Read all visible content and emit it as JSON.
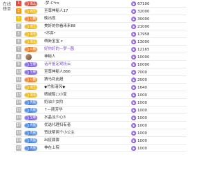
{
  "sidebar": {
    "label": "在线榜单"
  },
  "leaderboard": [
    {
      "rank": "1",
      "badge": "国王",
      "badge_color": "red",
      "name": "-梦-C*ro",
      "score": "67100"
    },
    {
      "rank": "2",
      "badge": "国王",
      "badge_color": "gold",
      "name": "至尊神秘人17",
      "score": "32000"
    },
    {
      "rank": "3",
      "badge": "公爵",
      "badge_color": "orange",
      "name": "晚出现",
      "score": "30000"
    },
    {
      "rank": "4",
      "badge": "国王",
      "badge_color": "gold",
      "name": "美好的你看来来88",
      "score": "21000"
    },
    {
      "rank": "5",
      "badge": "国王",
      "badge_color": "gold",
      "name": "*不弃*",
      "score": "17958"
    },
    {
      "rank": "6",
      "badge": "国王",
      "badge_color": "gold",
      "name": "萌新宝宝 c",
      "score": "13000"
    },
    {
      "rank": "7",
      "badge": "公爵",
      "badge_color": "orange",
      "name": "好你好的—梦~菌",
      "score": "12165"
    },
    {
      "rank": "8",
      "badge": "",
      "badge_color": "",
      "name": "神秘人",
      "score": "10000"
    },
    {
      "rank": "9",
      "badge": "至尊",
      "badge_color": "purple",
      "name": "话开鉴定观抚云",
      "score": "10000"
    },
    {
      "rank": "10",
      "badge": "至尊",
      "badge_color": "purple",
      "name": "至尊神秘人866",
      "score": "7000"
    },
    {
      "rank": "11",
      "badge": "公爵",
      "badge_color": "orange",
      "name": "猜马到此超",
      "score": "2000"
    },
    {
      "rank": "12",
      "badge": "国王",
      "badge_color": "gold",
      "name": "◆竹影清风◆",
      "score": "1640"
    },
    {
      "rank": "13",
      "badge": "国王",
      "badge_color": "gold",
      "name": "晒城醇□小宝",
      "score": "1000"
    },
    {
      "rank": "14",
      "badge": "贵族",
      "badge_color": "blue",
      "name": "奶油少女阶",
      "score": "1000"
    },
    {
      "rank": "15",
      "badge": "贵族",
      "badge_color": "blue",
      "name": "↑—随芳华",
      "score": "1000"
    },
    {
      "rank": "16",
      "badge": "至尊",
      "badge_color": "purple",
      "name": "水晶淡少心3",
      "score": "1000"
    },
    {
      "rank": "17",
      "badge": "贵族",
      "badge_color": "blue",
      "name": "优选代理扫有者",
      "score": "1000"
    },
    {
      "rank": "18",
      "badge": "贵族",
      "badge_color": "blue",
      "name": "赞送帮两个小公主",
      "score": "1000"
    },
    {
      "rank": "19",
      "badge": "贵族",
      "badge_color": "blue",
      "name": "出疫骤骤",
      "score": "1000"
    },
    {
      "rank": "20",
      "badge": "贵族",
      "badge_color": "blue",
      "name": "神在上院",
      "score": "1000"
    }
  ]
}
